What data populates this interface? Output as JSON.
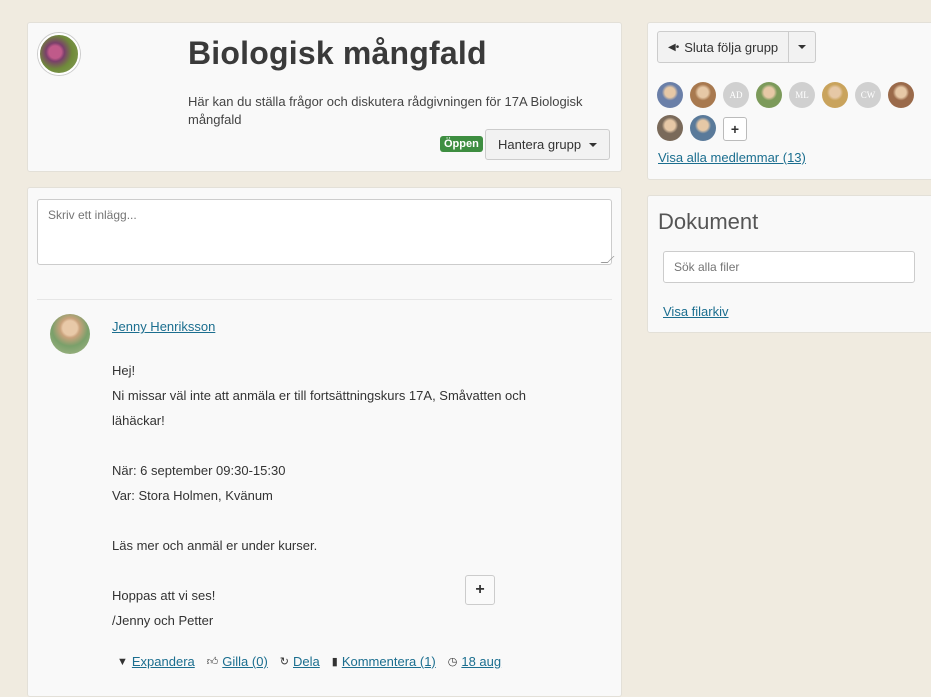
{
  "group": {
    "title": "Biologisk mångfald",
    "description": "Här kan du ställa frågor och diskutera rådgivningen för 17A Biologisk mångfald",
    "badge": "Öppen",
    "manage_label": "Hantera grupp"
  },
  "composer": {
    "placeholder": "Skriv ett inlägg..."
  },
  "post": {
    "author": "Jenny Henriksson",
    "lines": [
      "Hej!",
      "Ni missar väl inte att anmäla er till fortsättningskurs 17A, Småvatten och",
      "lähäckar!",
      "",
      "När: 6 september 09:30-15:30",
      "Var: Stora Holmen, Kvänum",
      "",
      "Läs mer och anmäl er under kurser.",
      "",
      "Hoppas att vi ses!",
      "/Jenny och Petter"
    ],
    "plus_label": "+",
    "actions": {
      "expand": "Expandera",
      "like": "Gilla (0)",
      "share": "Dela",
      "comment": "Kommentera (1)",
      "date": "18 aug"
    }
  },
  "follow": {
    "label": "Sluta följa grupp",
    "members_row1": [
      {
        "type": "photo",
        "color": "#6a7fa8"
      },
      {
        "type": "photo",
        "color": "#a8794f"
      },
      {
        "type": "initials",
        "text": "AD"
      },
      {
        "type": "photo",
        "color": "#7c9a5a"
      },
      {
        "type": "initials",
        "text": "ML"
      },
      {
        "type": "photo",
        "color": "#c9a35c"
      },
      {
        "type": "initials",
        "text": "CW"
      },
      {
        "type": "photo",
        "color": "#9a6a4a"
      }
    ],
    "members_row2": [
      {
        "type": "photo",
        "color": "#7a6a5a"
      },
      {
        "type": "photo",
        "color": "#5a7a9a"
      }
    ],
    "add_label": "+",
    "all_members": "Visa alla medlemmar (13)"
  },
  "documents": {
    "title": "Dokument",
    "search_placeholder": "Sök alla filer",
    "archive_link": "Visa filarkiv"
  }
}
